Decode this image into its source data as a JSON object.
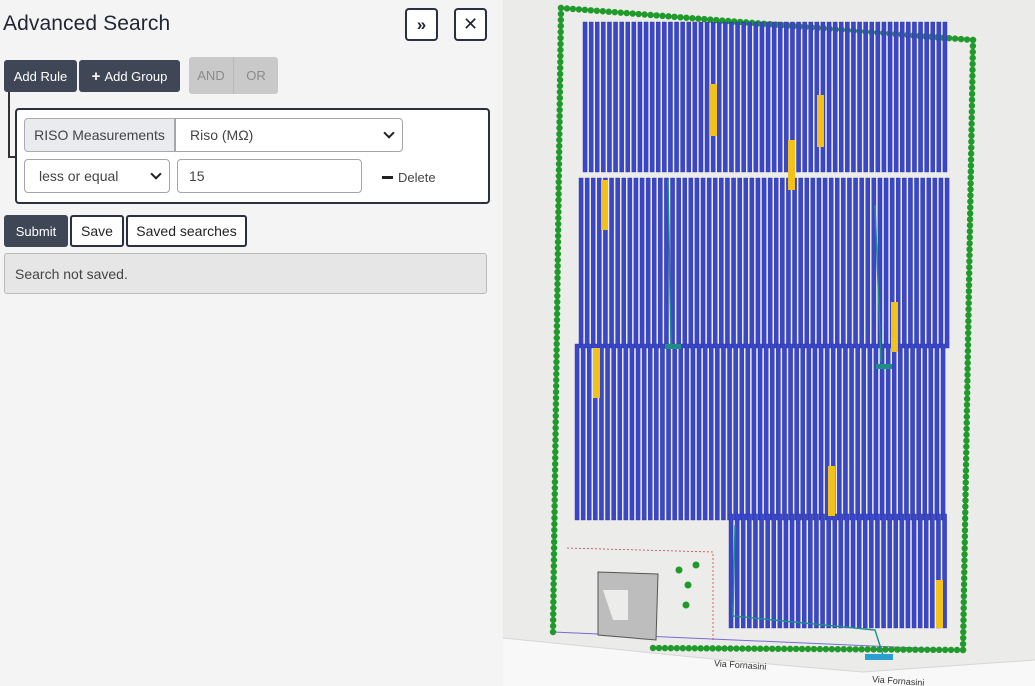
{
  "panel": {
    "title": "Advanced Search",
    "expand_icon": "»",
    "close_icon": "✕",
    "add_rule_label": "Add Rule",
    "add_group_label": "Add Group",
    "add_group_icon": "+",
    "and_label": "AND",
    "or_label": "OR",
    "rule": {
      "group": "RISO Measurements",
      "field": "Riso (MΩ)",
      "operator": "less or equal",
      "value": "15",
      "delete_label": "Delete"
    },
    "submit_label": "Submit",
    "save_label": "Save",
    "saved_searches_label": "Saved searches",
    "status_text": "Search not saved."
  },
  "map": {
    "road_labels": [
      "Via Fornasini",
      "Via Fornasini"
    ],
    "colors": {
      "panel_blue": "#3b47c9",
      "hedge_green": "#1f9a2b",
      "highlight_yellow": "#f2c21a",
      "cable_teal": "#1f8f86",
      "boundary_purple": "#7a6ad8"
    }
  }
}
